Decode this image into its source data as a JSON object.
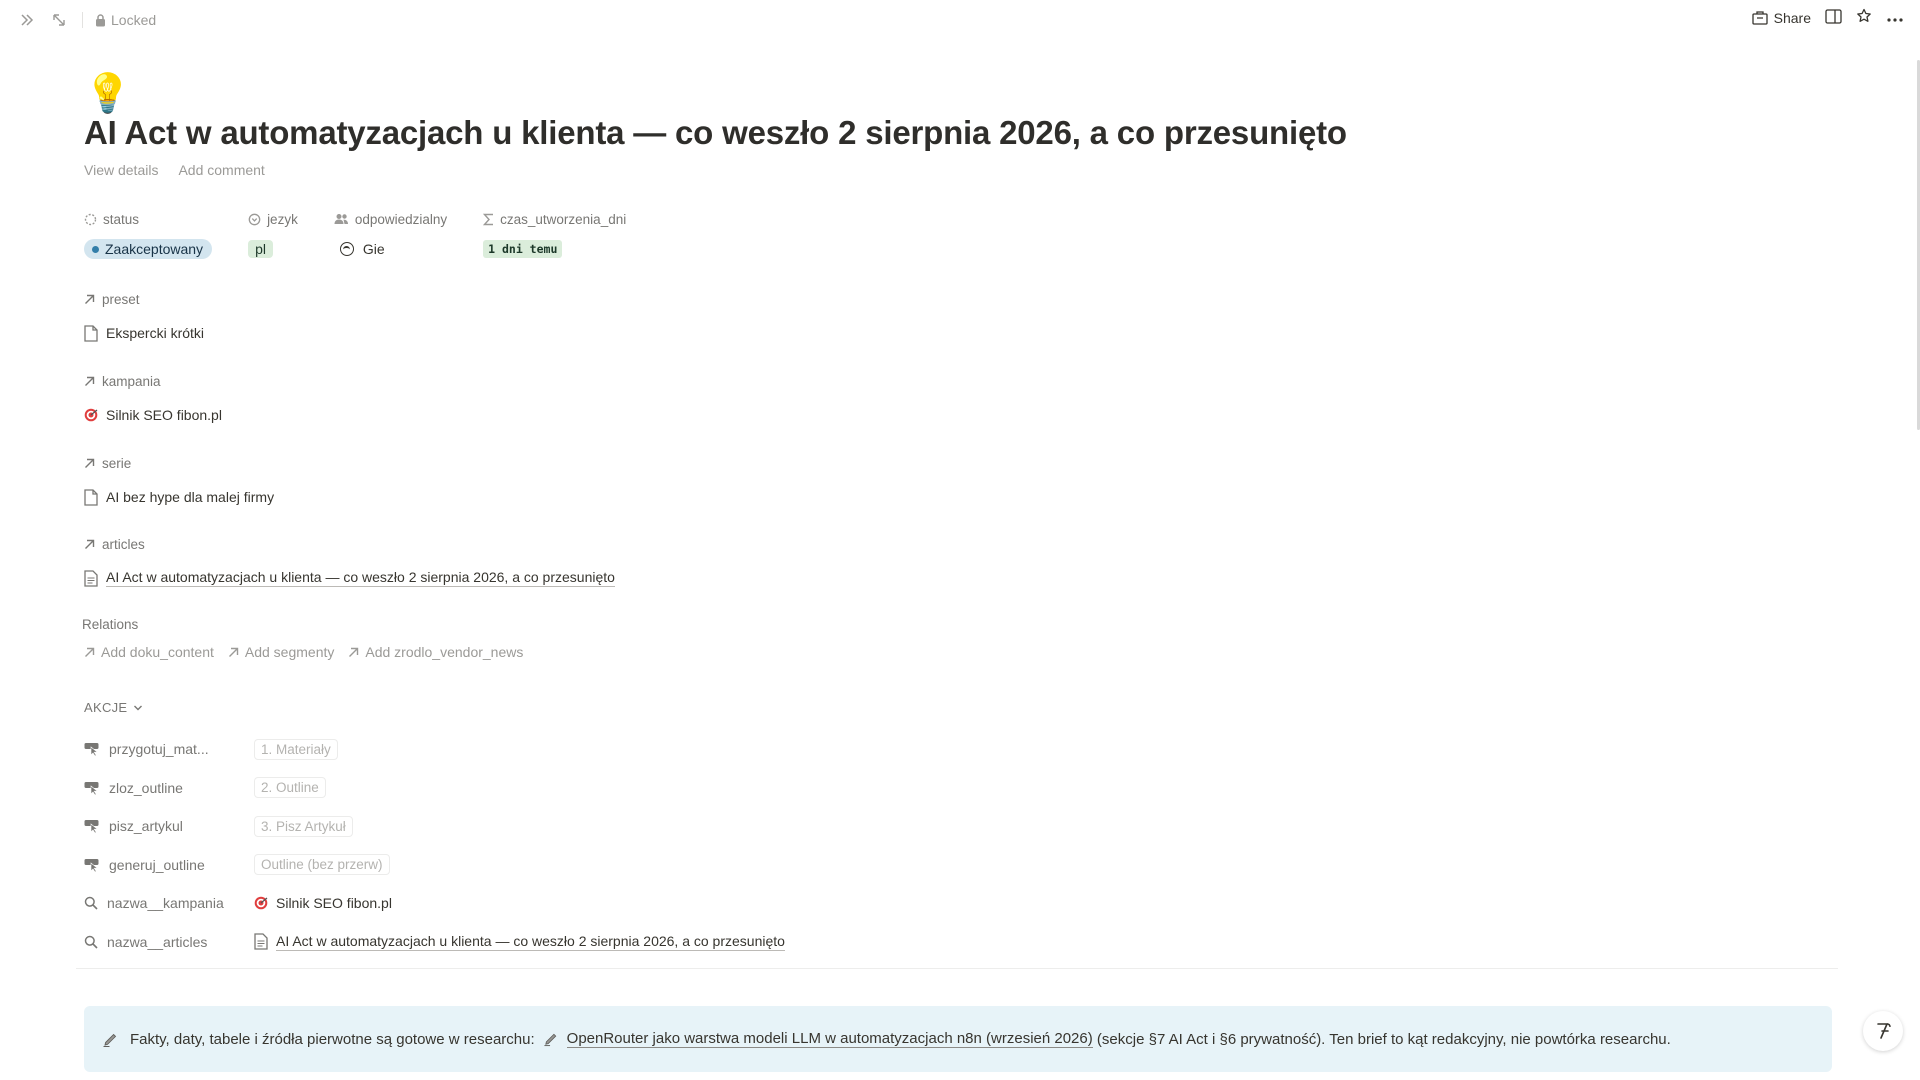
{
  "topbar": {
    "locked_label": "Locked",
    "share_label": "Share"
  },
  "page": {
    "emoji": "💡",
    "title": "AI Act w automatyzacjach u klienta — co weszło 2 sierpnia 2026, a co przesunięto",
    "view_details": "View details",
    "add_comment": "Add comment"
  },
  "properties": {
    "status": {
      "label": "status",
      "value": "Zaakceptowany"
    },
    "jezyk": {
      "label": "jezyk",
      "value": "pl"
    },
    "odpowiedzialny": {
      "label": "odpowiedzialny",
      "value": "Gie"
    },
    "czas": {
      "label": "czas_utworzenia_dni",
      "value": "1 dni temu"
    }
  },
  "relations": {
    "preset": {
      "label": "preset",
      "item": "Ekspercki krótki"
    },
    "kampania": {
      "label": "kampania",
      "item": "Silnik SEO fibon.pl"
    },
    "serie": {
      "label": "serie",
      "item": "AI bez hype dla malej firmy"
    },
    "articles": {
      "label": "articles",
      "item": "AI Act w automatyzacjach u klienta — co weszło 2 sierpnia 2026, a co przesunięto"
    },
    "section_title": "Relations",
    "add": [
      "Add doku_content",
      "Add segmenty",
      "Add zrodlo_vendor_news"
    ]
  },
  "akcje": {
    "label": "AKCJE",
    "rows": [
      {
        "name": "przygotuj_mat...",
        "button": "1. Materiały"
      },
      {
        "name": "zloz_outline",
        "button": "2. Outline"
      },
      {
        "name": "pisz_artykul",
        "button": "3. Pisz Artykuł"
      },
      {
        "name": "generuj_outline",
        "button": "Outline (bez przerw)"
      },
      {
        "name": "nazwa__kampania",
        "value": "Silnik SEO fibon.pl"
      },
      {
        "name": "nazwa__articles",
        "value": "AI Act w automatyzacjach u klienta — co weszło 2 sierpnia 2026, a co przesunięto"
      }
    ]
  },
  "callout": {
    "text_before": "Fakty, daty, tabele i źródła pierwotne są gotowe w researchu:",
    "link": "OpenRouter jako warstwa modeli LLM w automatyzacjach n8n (wrzesień 2026)",
    "text_after": " (sekcje §7 AI Act i §6 prywatność). Ten brief to kąt redakcyjny, nie powtórka researchu."
  },
  "colors": {
    "status_pill": "#d3e5ef",
    "status_dot": "#337ea9",
    "green_pill": "#dbeddb",
    "callout_bg": "#e7f3f8"
  }
}
